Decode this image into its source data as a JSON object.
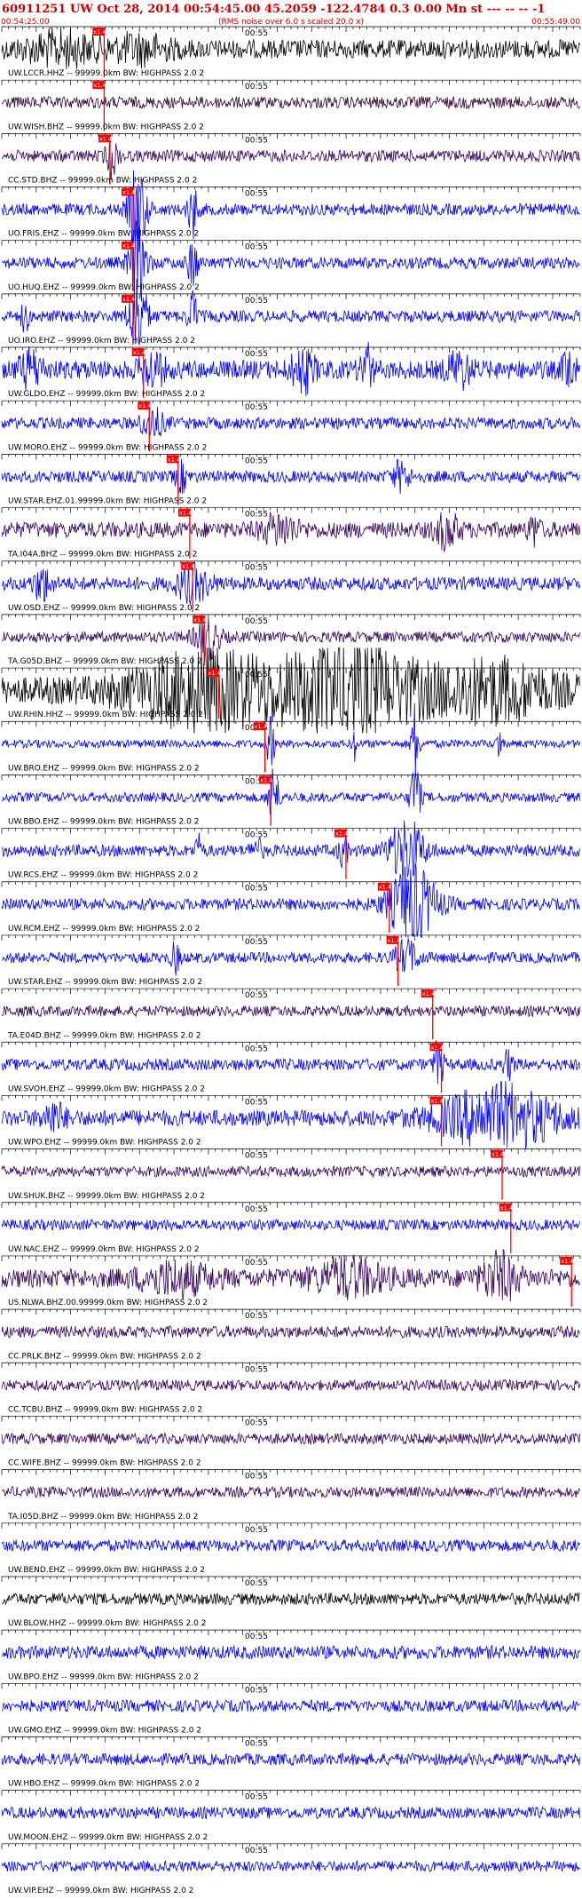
{
  "chart_data": {
    "type": "line",
    "title": "60911251 UW Oct 28, 2014 00:54:45.00   45.2059 -122.4784  0.3 0.00 Mn st --- -- --  -1",
    "subtitle": "(RMS noise over 6.0 s scaled 20.0 x)",
    "start_time": "00:54:25.00",
    "end_time": "00:55:49.00",
    "mid_tick_label": "00:55",
    "pick_label": "x1.4",
    "colors": {
      "header": "#cc0000",
      "pick": "#ff0000",
      "grid": "#000000"
    },
    "traces": [
      {
        "label": "UW.LCCR.HHZ -- 99999.0km BW: HIGHPASS  2.0  2",
        "color": "#000000",
        "pick_frac": 0.177,
        "amp": 0.35,
        "events": [
          [
            0.1,
            0.5,
            0.06
          ],
          [
            0.24,
            0.4,
            0.05
          ]
        ]
      },
      {
        "label": "UW.WISH.BHZ -- 99999.0km BW: HIGHPASS  2.0  2",
        "color": "#330033",
        "pick_frac": 0.177,
        "amp": 0.22,
        "events": []
      },
      {
        "label": "CC.STD.BHZ -- 99999.0km BW: HIGHPASS  2.0  2",
        "color": "#330055",
        "pick_frac": 0.187,
        "amp": 0.22,
        "events": [
          [
            0.19,
            0.7,
            0.01
          ]
        ]
      },
      {
        "label": "UO.FRIS.EHZ -- 99999.0km BW: HIGHPASS  2.0  2",
        "color": "#0000ee",
        "pick_frac": 0.227,
        "amp": 0.22,
        "events": [
          [
            0.235,
            1.6,
            0.015
          ],
          [
            0.33,
            1.0,
            0.008
          ]
        ]
      },
      {
        "label": "UO.HUQ.EHZ -- 99999.0km BW: HIGHPASS  2.0  2",
        "color": "#0000ee",
        "pick_frac": 0.227,
        "amp": 0.22,
        "events": [
          [
            0.235,
            1.5,
            0.015
          ],
          [
            0.33,
            0.9,
            0.008
          ]
        ]
      },
      {
        "label": "UO.IRO.EHZ -- 99999.0km BW: HIGHPASS  2.0  2",
        "color": "#0000ee",
        "pick_frac": 0.227,
        "amp": 0.22,
        "events": [
          [
            0.04,
            0.6,
            0.006
          ],
          [
            0.235,
            1.6,
            0.015
          ],
          [
            0.33,
            0.9,
            0.008
          ]
        ]
      },
      {
        "label": "UW.GLDO.EHZ -- 99999.0km BW: HIGHPASS  2.0  2",
        "color": "#0000ee",
        "pick_frac": 0.245,
        "amp": 0.35,
        "events": [
          [
            0.05,
            0.6,
            0.02
          ],
          [
            0.26,
            0.6,
            0.02
          ],
          [
            0.52,
            0.7,
            0.02
          ],
          [
            0.63,
            0.9,
            0.01
          ],
          [
            0.79,
            0.6,
            0.02
          ],
          [
            0.98,
            0.8,
            0.01
          ]
        ]
      },
      {
        "label": "UW.MORO.EHZ -- 99999.0km BW: HIGHPASS  2.0  2",
        "color": "#0000ee",
        "pick_frac": 0.255,
        "amp": 0.22,
        "events": [
          [
            0.26,
            0.5,
            0.02
          ]
        ]
      },
      {
        "label": "UW.STAR.EHZ.01.99999.0km BW: HIGHPASS  2.0  2",
        "color": "#0000ee",
        "pick_frac": 0.305,
        "amp": 0.22,
        "events": [
          [
            0.31,
            0.5,
            0.01
          ],
          [
            0.69,
            0.5,
            0.015
          ]
        ]
      },
      {
        "label": "TA.I04A.BHZ -- 99999.0km BW: HIGHPASS  2.0  2",
        "color": "#330055",
        "pick_frac": 0.325,
        "amp": 0.3,
        "events": [
          [
            0.48,
            0.5,
            0.03
          ],
          [
            0.77,
            0.6,
            0.02
          ],
          [
            0.92,
            0.5,
            0.01
          ]
        ]
      },
      {
        "label": "UW.OSD.EHZ -- 99999.0km BW: HIGHPASS  2.0  2",
        "color": "#0000ee",
        "pick_frac": 0.33,
        "amp": 0.25,
        "events": [
          [
            0.07,
            0.6,
            0.015
          ],
          [
            0.33,
            0.6,
            0.03
          ]
        ]
      },
      {
        "label": "TA.G05D.BHZ -- 99999.0km BW: HIGHPASS  2.0  2",
        "color": "#330055",
        "pick_frac": 0.35,
        "amp": 0.2,
        "events": [
          [
            0.355,
            0.8,
            0.02
          ]
        ]
      },
      {
        "label": "UW.RHIN.HHZ -- 99999.0km BW: HIGHPASS  2.0  2",
        "color": "#000000",
        "pick_frac": 0.375,
        "amp": 0.5,
        "events": [
          [
            0.35,
            1.2,
            0.12
          ],
          [
            0.6,
            1.5,
            0.12
          ],
          [
            0.85,
            0.9,
            0.1
          ]
        ]
      },
      {
        "label": "UW.BRO.EHZ -- 99999.0km BW: HIGHPASS  2.0  2",
        "color": "#0000ee",
        "pick_frac": 0.455,
        "amp": 0.15,
        "events": [
          [
            0.465,
            1.0,
            0.006
          ],
          [
            0.61,
            0.6,
            0.004
          ],
          [
            0.715,
            1.6,
            0.006
          ],
          [
            0.86,
            0.7,
            0.004
          ]
        ]
      },
      {
        "label": "UW.BBO.EHZ -- 99999.0km BW: HIGHPASS  2.0  2",
        "color": "#0000ee",
        "pick_frac": 0.465,
        "amp": 0.18,
        "events": [
          [
            0.47,
            1.3,
            0.008
          ],
          [
            0.715,
            1.4,
            0.008
          ]
        ]
      },
      {
        "label": "UW.RCS.EHZ -- 99999.0km BW: HIGHPASS  2.0  2",
        "color": "#0000ee",
        "pick_frac": 0.595,
        "amp": 0.22,
        "events": [
          [
            0.34,
            0.5,
            0.006
          ],
          [
            0.44,
            0.4,
            0.01
          ],
          [
            0.59,
            0.6,
            0.008
          ],
          [
            0.7,
            1.1,
            0.03
          ]
        ]
      },
      {
        "label": "UW.RCM.EHZ -- 99999.0km BW: HIGHPASS  2.0  2",
        "color": "#0000ee",
        "pick_frac": 0.67,
        "amp": 0.22,
        "events": [
          [
            0.71,
            1.4,
            0.04
          ]
        ]
      },
      {
        "label": "UW.STAR.EHZ -- 99999.0km BW: HIGHPASS  2.0  2",
        "color": "#0000ee",
        "pick_frac": 0.685,
        "amp": 0.2,
        "events": [
          [
            0.3,
            0.5,
            0.008
          ],
          [
            0.7,
            0.6,
            0.02
          ]
        ]
      },
      {
        "label": "TA.E04D.BHZ -- 99999.0km BW: HIGHPASS  2.0  2",
        "color": "#330055",
        "pick_frac": 0.745,
        "amp": 0.2,
        "events": []
      },
      {
        "label": "UW.SVOH.EHZ -- 99999.0km BW: HIGHPASS  2.0  2",
        "color": "#0000ee",
        "pick_frac": 0.76,
        "amp": 0.22,
        "events": [
          [
            0.755,
            0.9,
            0.008
          ],
          [
            0.875,
            0.5,
            0.008
          ]
        ]
      },
      {
        "label": "UW.WPO.EHZ -- 99999.0km BW: HIGHPASS  2.0  2",
        "color": "#0000ee",
        "pick_frac": 0.76,
        "amp": 0.3,
        "events": [
          [
            0.09,
            0.5,
            0.02
          ],
          [
            0.86,
            1.1,
            0.1
          ]
        ]
      },
      {
        "label": "UW.SHUK.BHZ -- 99999.0km BW: HIGHPASS  2.0  2",
        "color": "#330055",
        "pick_frac": 0.865,
        "amp": 0.2,
        "events": []
      },
      {
        "label": "UW.NAC.EHZ -- 99999.0km BW: HIGHPASS  2.0  2",
        "color": "#0000ee",
        "pick_frac": 0.88,
        "amp": 0.2,
        "events": []
      },
      {
        "label": "US.NLWA.BHZ.00.99999.0km BW: HIGHPASS  2.0  2",
        "color": "#330055",
        "pick_frac": 0.985,
        "amp": 0.35,
        "events": [
          [
            0.3,
            0.5,
            0.06
          ],
          [
            0.6,
            0.6,
            0.06
          ],
          [
            0.86,
            0.8,
            0.03
          ]
        ]
      },
      {
        "label": "CC.PRLK.BHZ -- 99999.0km BW: HIGHPASS  2.0  2",
        "color": "#330055",
        "pick_frac": null,
        "amp": 0.22,
        "events": []
      },
      {
        "label": "CC.TCBU.BHZ -- 99999.0km BW: HIGHPASS  2.0  2",
        "color": "#330055",
        "pick_frac": null,
        "amp": 0.2,
        "events": []
      },
      {
        "label": "CC.WIFE.BHZ -- 99999.0km BW: HIGHPASS  2.0  2",
        "color": "#330055",
        "pick_frac": null,
        "amp": 0.2,
        "events": []
      },
      {
        "label": "TA.I05D.BHZ -- 99999.0km BW: HIGHPASS  2.0  2",
        "color": "#330055",
        "pick_frac": null,
        "amp": 0.2,
        "events": []
      },
      {
        "label": "UW.BEND.EHZ -- 99999.0km BW: HIGHPASS  2.0  2",
        "color": "#0000ee",
        "pick_frac": null,
        "amp": 0.22,
        "events": []
      },
      {
        "label": "UW.BLOW.HHZ -- 99999.0km BW: HIGHPASS  2.0  2",
        "color": "#000000",
        "pick_frac": null,
        "amp": 0.22,
        "events": []
      },
      {
        "label": "UW.BPO.EHZ -- 99999.0km BW: HIGHPASS  2.0  2",
        "color": "#0000ee",
        "pick_frac": null,
        "amp": 0.25,
        "events": []
      },
      {
        "label": "UW.GMO.EHZ -- 99999.0km BW: HIGHPASS  2.0  2",
        "color": "#0000ee",
        "pick_frac": null,
        "amp": 0.22,
        "events": []
      },
      {
        "label": "UW.HBO.EHZ -- 99999.0km BW: HIGHPASS  2.0  2",
        "color": "#0000ee",
        "pick_frac": null,
        "amp": 0.22,
        "events": []
      },
      {
        "label": "UW.MOON.EHZ -- 99999.0km BW: HIGHPASS  2.0  2",
        "color": "#0000ee",
        "pick_frac": null,
        "amp": 0.22,
        "events": []
      },
      {
        "label": "UW.VIP.EHZ -- 99999.0km BW: HIGHPASS  2.0  2",
        "color": "#0000ee",
        "pick_frac": null,
        "amp": 0.2,
        "events": []
      }
    ]
  }
}
